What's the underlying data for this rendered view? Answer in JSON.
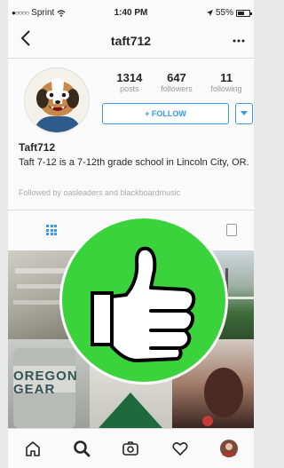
{
  "status_bar": {
    "carrier": "Sprint",
    "time": "1:40 PM",
    "battery": "55%",
    "battery_level": 0.55
  },
  "header": {
    "title": "taft712",
    "back_icon": "chevron-left-icon",
    "more_icon": "more-horizontal-icon"
  },
  "profile": {
    "stats": [
      {
        "count": "1314",
        "label": "posts"
      },
      {
        "count": "647",
        "label": "followers"
      },
      {
        "count": "11",
        "label": "following"
      }
    ],
    "follow_label": "+ FOLLOW",
    "name": "Taft712",
    "bio": "Taft 7-12 is a 7-12th grade school in Lincoln City, OR.",
    "followed_by": "Followed by oasleaders and blackboardmusic"
  },
  "grid_photo_text": "OREGON GEAR",
  "bottom_nav": [
    "home-icon",
    "search-icon",
    "camera-icon",
    "heart-icon",
    "profile-avatar"
  ],
  "colors": {
    "accent": "#3897f0",
    "thumb_green": "#3bd33b"
  }
}
